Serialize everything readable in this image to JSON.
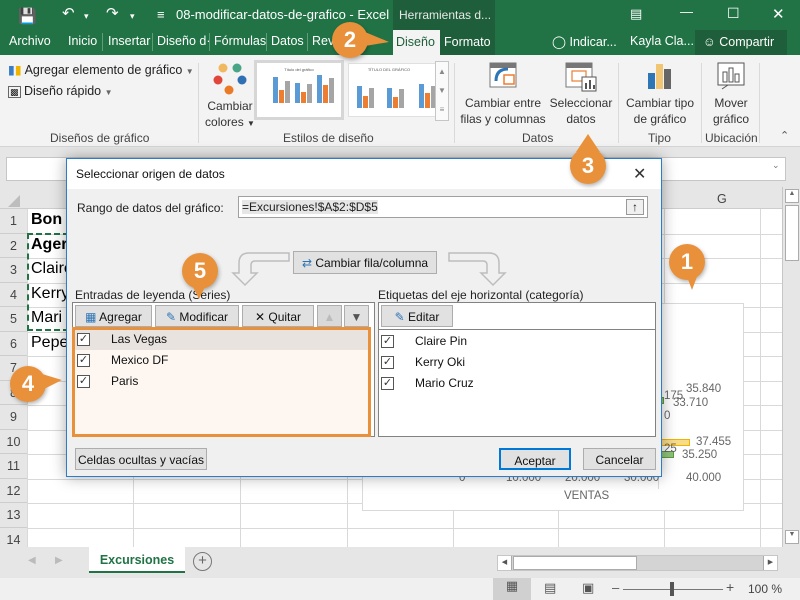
{
  "window": {
    "title": "08-modificar-datos-de-grafico  -  Excel",
    "context_tab_group": "Herramientas d...",
    "qat_more": "≡"
  },
  "tabs": {
    "items": [
      "Archivo",
      "Inicio",
      "Insertar",
      "Diseño d·",
      "Fórmulas",
      "Datos",
      "Revi"
    ],
    "active": "Diseño",
    "formato": "Formato",
    "tell_me": "Indicar...",
    "user": "Kayla Cla...",
    "share": "Compartir"
  },
  "ribbon": {
    "add_element": "Agregar elemento de gráfico",
    "quick_layout": "Diseño rápido",
    "change_colors_1": "Cambiar",
    "change_colors_2": "colores",
    "group_chart_layouts": "Diseños de gráfico",
    "group_chart_styles": "Estilos de diseño",
    "switch_row_col_1": "Cambiar entre",
    "switch_row_col_2": "filas y columnas",
    "select_data_1": "Seleccionar",
    "select_data_2": "datos",
    "group_data": "Datos",
    "change_type_1": "Cambiar tipo",
    "change_type_2": "de gráfico",
    "group_type": "Tipo",
    "move_chart_1": "Mover",
    "move_chart_2": "gráfico",
    "group_location": "Ubicación",
    "style_thumb_1_title": "Título del gráfico",
    "style_thumb_2_title": "TÍTULO DEL GRÁFICO"
  },
  "sheet": {
    "rows": [
      "1",
      "2",
      "3",
      "4",
      "5",
      "6",
      "7",
      "8",
      "9",
      "10",
      "11",
      "12",
      "13",
      "14"
    ],
    "cells": [
      "Bon V",
      "Ager",
      "Claire",
      "Kerry",
      "Mari",
      "Pepe"
    ],
    "column_g": "G",
    "sheet_tab": "Excursiones",
    "zoom": "100 %"
  },
  "chart": {
    "labels": [
      "35.840",
      "33.710",
      "37.455",
      "35.250",
      "175",
      "25",
      "0"
    ],
    "axis_ticks": [
      "0",
      "10.000",
      "20.000",
      "30.000",
      "40.000"
    ],
    "axis_title": "VENTAS",
    "colors": {
      "series_yellow": "#f5c342",
      "series_green": "#70ad47"
    }
  },
  "dialog": {
    "title": "Seleccionar origen de datos",
    "range_label": "Rango de datos del gráfico:",
    "range_value": "=Excursiones!$A$2:$D$5",
    "switch_button": "Cambiar fila/columna",
    "legend_title": "Entradas de leyenda (Series)",
    "add": "Agregar",
    "edit": "Modificar",
    "remove": "Quitar",
    "series": [
      {
        "name": "Las Vegas",
        "checked": true
      },
      {
        "name": "Mexico DF",
        "checked": true
      },
      {
        "name": "Paris",
        "checked": true
      }
    ],
    "axis_title": "Etiquetas del eje horizontal (categoría)",
    "axis_edit": "Editar",
    "categories": [
      {
        "name": "Claire Pin",
        "checked": true
      },
      {
        "name": "Kerry Oki",
        "checked": true
      },
      {
        "name": "Mario Cruz",
        "checked": true
      }
    ],
    "hidden_cells": "Celdas ocultas y vacías",
    "ok": "Aceptar",
    "cancel": "Cancelar"
  },
  "callouts": [
    "1",
    "2",
    "3",
    "4",
    "5"
  ],
  "colors": {
    "excel_green": "#217346",
    "callout_orange": "#e8913a",
    "dialog_border": "#2c7dc9"
  }
}
